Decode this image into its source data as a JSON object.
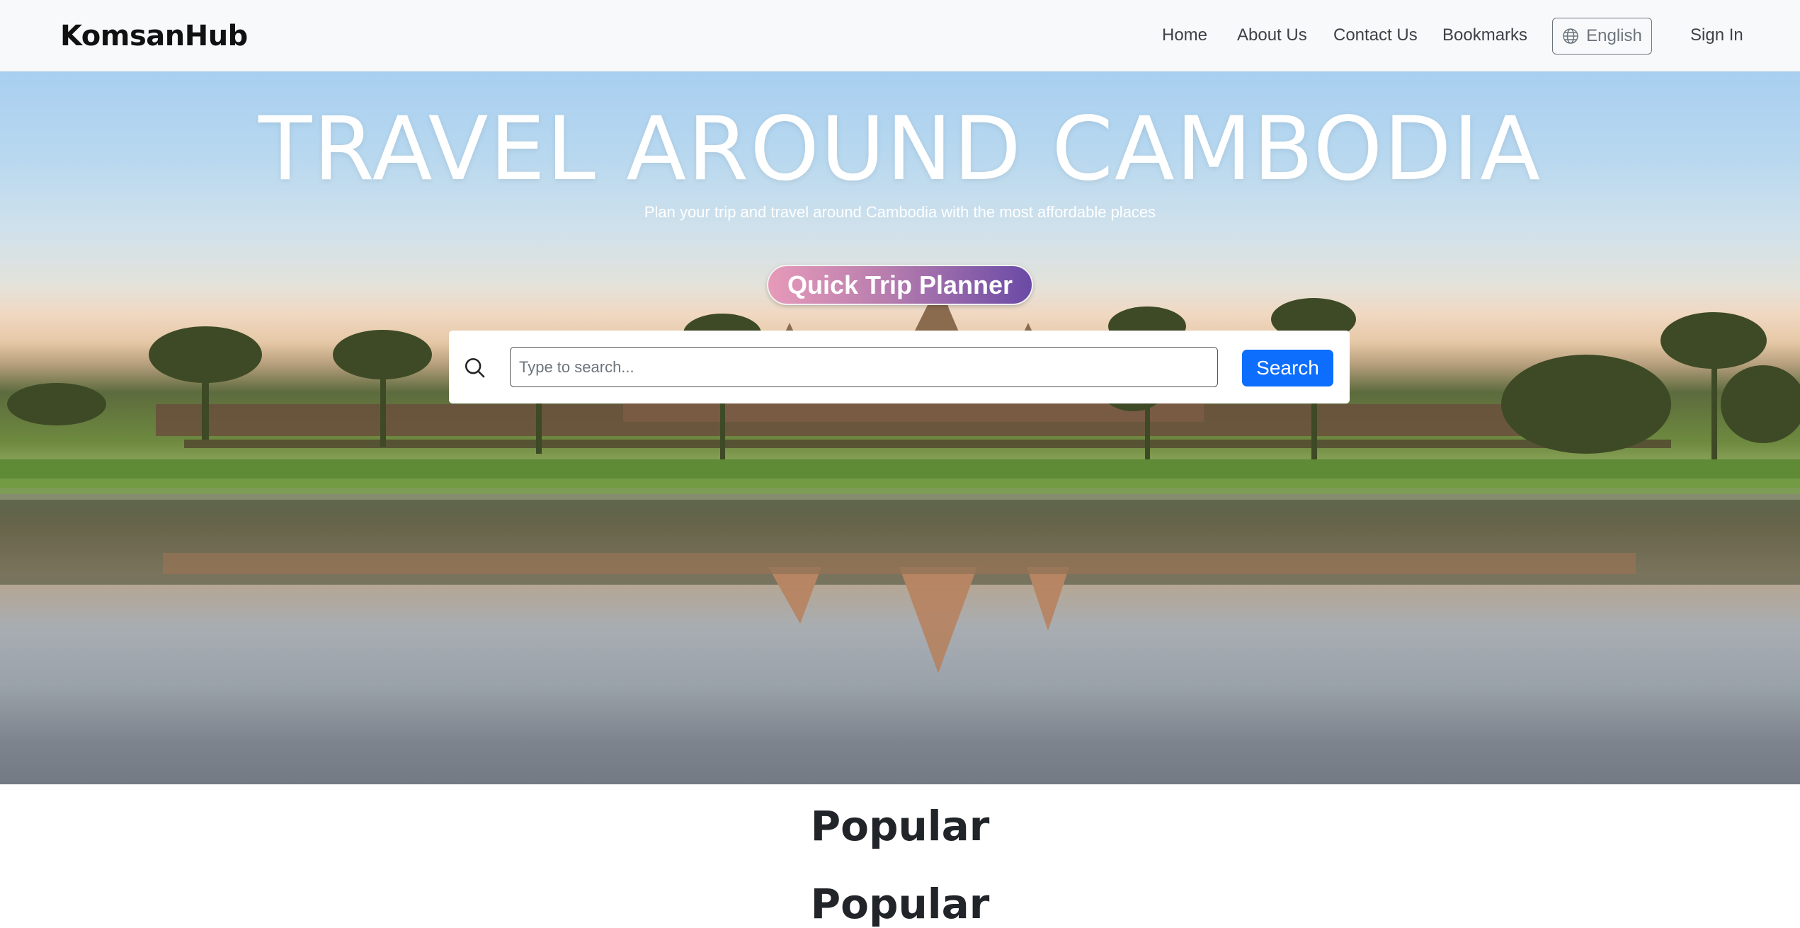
{
  "navbar": {
    "brand": "KomsanHub",
    "links": {
      "home": "Home",
      "about": "About Us",
      "contact": "Contact Us",
      "bookmarks": "Bookmarks"
    },
    "language": "English",
    "sign_in": "Sign In"
  },
  "hero": {
    "title": "TRAVEL AROUND CAMBODIA",
    "subtitle": "Plan your trip and travel around Cambodia with the most affordable places",
    "quick_trip_label": "Quick Trip Planner",
    "search": {
      "placeholder": "Type to search...",
      "value": "",
      "button_label": "Search"
    }
  },
  "sections": {
    "popular_title": "Popular",
    "next_title": "Popular"
  },
  "colors": {
    "primary": "#0d6efd",
    "navbar_bg": "#f8f9fa",
    "quick_trip_gradient_start": "#e79ab9",
    "quick_trip_gradient_end": "#6a4aa6"
  },
  "icons": {
    "language": "globe-icon",
    "search": "search-icon"
  }
}
